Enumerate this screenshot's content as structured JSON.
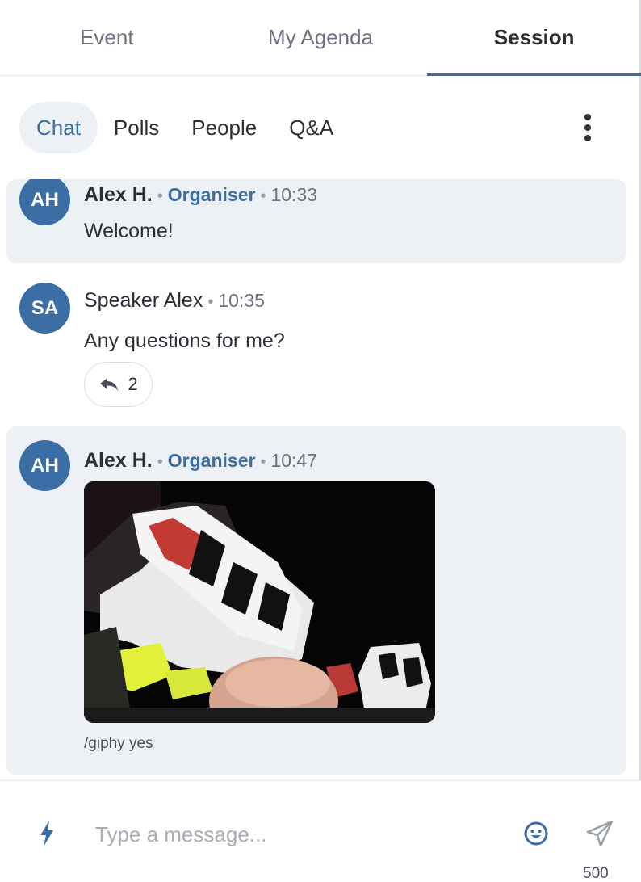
{
  "top_tabs": [
    {
      "label": "Event",
      "active": false
    },
    {
      "label": "My Agenda",
      "active": false
    },
    {
      "label": "Session",
      "active": true
    }
  ],
  "sub_tabs": [
    {
      "label": "Chat",
      "active": true
    },
    {
      "label": "Polls",
      "active": false
    },
    {
      "label": "People",
      "active": false
    },
    {
      "label": "Q&A",
      "active": false
    }
  ],
  "more_icon": "vertical-ellipsis-icon",
  "messages": [
    {
      "initials": "AH",
      "author": "Alex H.",
      "role": "Organiser",
      "time": "10:33",
      "text": "Welcome!"
    },
    {
      "initials": "SA",
      "author": "Speaker Alex",
      "time": "10:35",
      "text": "Any questions for me?",
      "reply_count": "2",
      "reply_icon": "reply-arrow-icon"
    },
    {
      "initials": "AH",
      "author": "Alex H.",
      "role": "Organiser",
      "time": "10:47",
      "gif_caption": "/giphy yes",
      "gif_icon": "gif-image"
    }
  ],
  "composer": {
    "placeholder": "Type a message...",
    "char_count": "500",
    "left_icon": "lightning-bolt-icon",
    "emoji_icon": "smiley-icon",
    "send_icon": "send-paper-plane-icon"
  },
  "colors": {
    "accent": "#3b6ea5",
    "highlight_bg": "#edf1f5",
    "text": "#2b2f36",
    "muted": "#6b7280"
  }
}
